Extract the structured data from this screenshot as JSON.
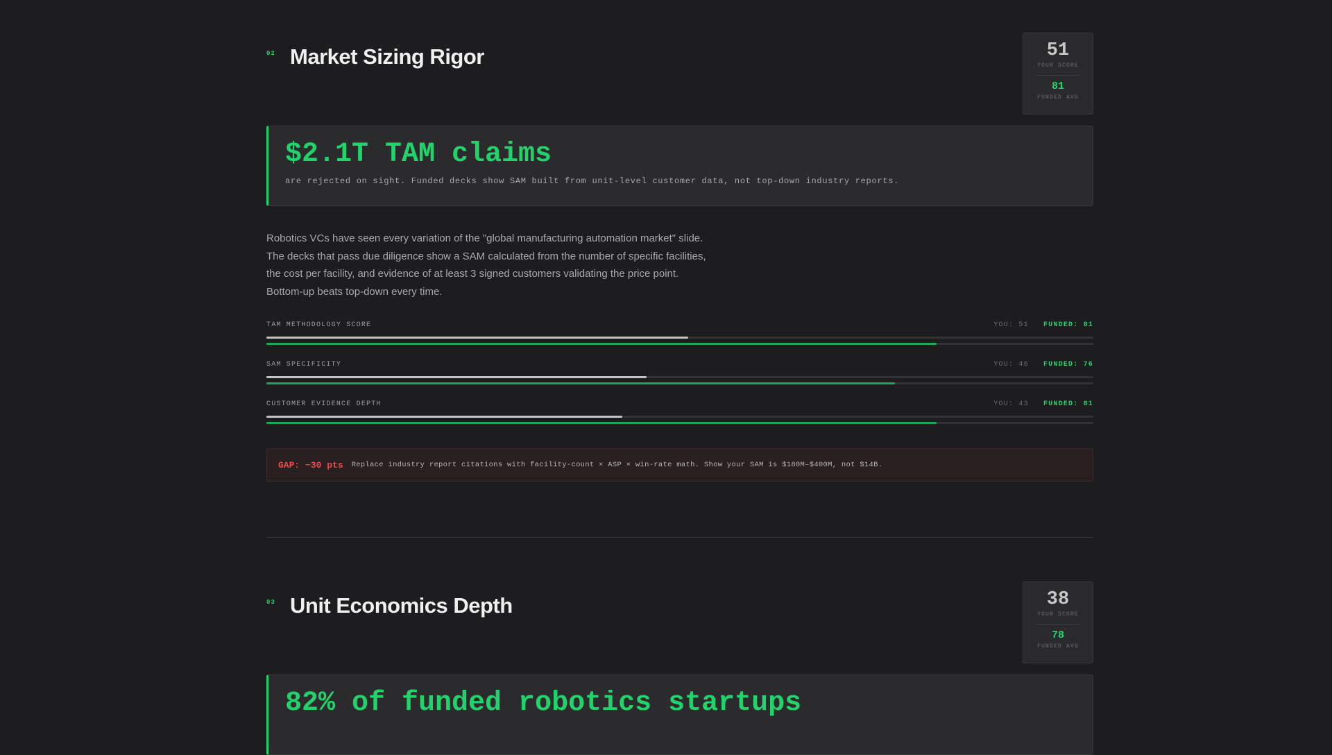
{
  "sections": [
    {
      "number": "02",
      "title": "Market Sizing Rigor",
      "score": {
        "you": "51",
        "you_label": "YOUR SCORE",
        "funded": "81",
        "funded_label": "FUNDED AVG"
      },
      "callout": {
        "headline": "$2.1T TAM claims",
        "sub": "are rejected on sight. Funded decks show SAM built from unit-level customer data, not top-down industry reports."
      },
      "body_lines": [
        "Robotics VCs have seen every variation of the \"global manufacturing automation market\" slide.",
        "The decks that pass due diligence show a SAM calculated from the number of specific facilities,",
        "the cost per facility, and evidence of at least 3 signed customers validating the price point.",
        "Bottom-up beats top-down every time."
      ],
      "metrics": [
        {
          "label": "TAM METHODOLOGY SCORE",
          "you_text": "YOU: 51",
          "funded_text": "FUNDED: 81",
          "you": 51,
          "funded": 81
        },
        {
          "label": "SAM SPECIFICITY",
          "you_text": "YOU: 46",
          "funded_text": "FUNDED: 76",
          "you": 46,
          "funded": 76
        },
        {
          "label": "CUSTOMER EVIDENCE DEPTH",
          "you_text": "YOU: 43",
          "funded_text": "FUNDED: 81",
          "you": 43,
          "funded": 81
        }
      ],
      "gap": {
        "label": "GAP: −30 pts",
        "text": "Replace industry report citations with facility-count × ASP × win-rate math. Show your SAM is $180M–$400M, not $14B."
      }
    },
    {
      "number": "03",
      "title": "Unit Economics Depth",
      "score": {
        "you": "38",
        "you_label": "YOUR SCORE",
        "funded": "78",
        "funded_label": "FUNDED AVG"
      },
      "callout": {
        "headline": "82% of funded robotics startups"
      }
    }
  ],
  "colors": {
    "accent": "#22d36b",
    "gap": "#f0484a",
    "background": "#1d1d1f"
  }
}
